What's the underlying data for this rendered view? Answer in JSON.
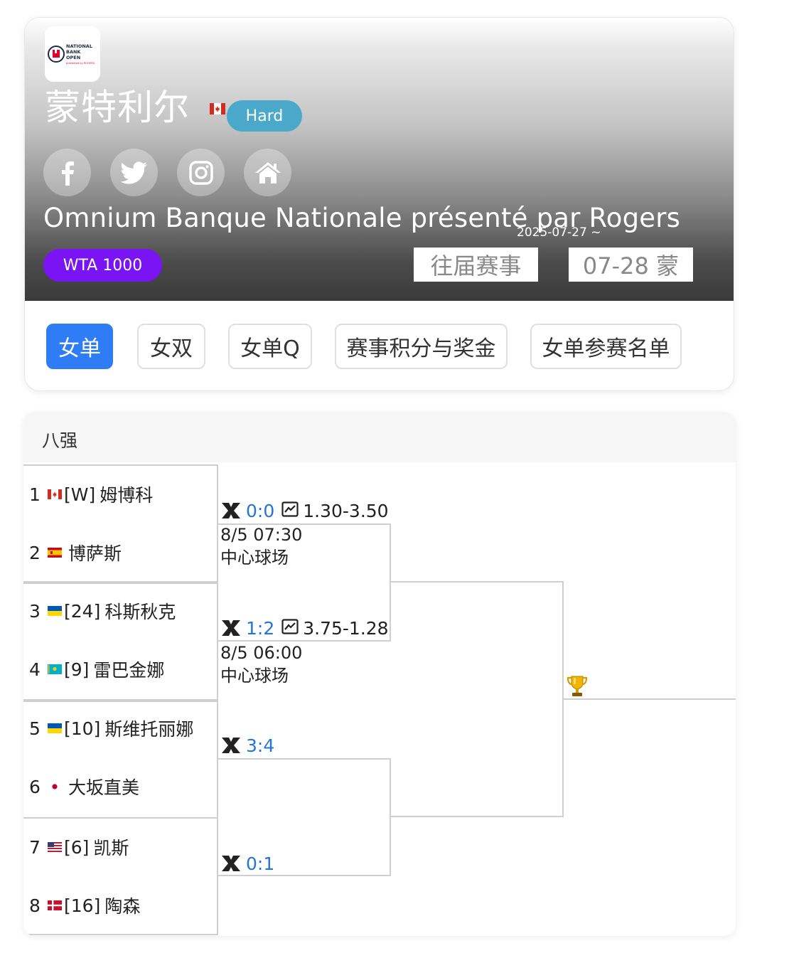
{
  "header": {
    "logo_text_lines": [
      "NATIONAL",
      "BANK",
      "OPEN"
    ],
    "logo_sub": "presented by ROGERS",
    "city": "蒙特利尔",
    "country_flag_icon": "flag-canada-icon",
    "surface": "Hard",
    "social": [
      "facebook-icon",
      "twitter-icon",
      "instagram-icon",
      "home-icon"
    ],
    "tournament_name": "Omnium Banque Nationale présenté par Rogers",
    "date_range": "2025-07-27 ~",
    "tour_level": "WTA 1000",
    "previous_label": "往届赛事",
    "date_chip": "07-28 蒙",
    "colors": {
      "surface": "#4aa9cb",
      "tour": "#7a14f5",
      "active_tab": "#2f7df6",
      "score": "#2575d8"
    }
  },
  "tabs": [
    {
      "label": "女单",
      "active": true
    },
    {
      "label": "女双",
      "active": false
    },
    {
      "label": "女单Q",
      "active": false
    },
    {
      "label": "赛事积分与奖金",
      "active": false
    },
    {
      "label": "女单参赛名单",
      "active": false
    }
  ],
  "bracket": {
    "round_title": "八强",
    "players": [
      {
        "num": "1",
        "flag": "canada",
        "seed": "[W]",
        "name": "姆博科"
      },
      {
        "num": "2",
        "flag": "spain",
        "seed": "",
        "name": "博萨斯"
      },
      {
        "num": "3",
        "flag": "ukraine",
        "seed": "[24]",
        "name": "科斯秋克"
      },
      {
        "num": "4",
        "flag": "kazakhstan",
        "seed": "[9]",
        "name": "雷巴金娜"
      },
      {
        "num": "5",
        "flag": "ukraine",
        "seed": "[10]",
        "name": "斯维托丽娜"
      },
      {
        "num": "6",
        "flag": "japan",
        "seed": "",
        "name": "大坂直美"
      },
      {
        "num": "7",
        "flag": "usa",
        "seed": "[6]",
        "name": "凯斯"
      },
      {
        "num": "8",
        "flag": "denmark",
        "seed": "[16]",
        "name": "陶森"
      }
    ],
    "matches": [
      {
        "score": "0:0",
        "odds": "1.30-3.50",
        "time": "8/5 07:30",
        "court": "中心球场"
      },
      {
        "score": "1:2",
        "odds": "3.75-1.28",
        "time": "8/5 06:00",
        "court": "中心球场"
      },
      {
        "score": "3:4",
        "odds": "",
        "time": "",
        "court": ""
      },
      {
        "score": "0:1",
        "odds": "",
        "time": "",
        "court": ""
      }
    ],
    "trophy_icon": "trophy-icon"
  }
}
